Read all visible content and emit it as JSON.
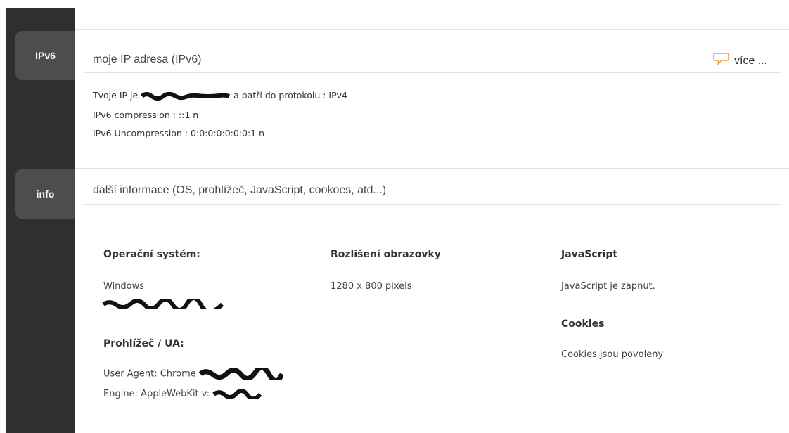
{
  "tabs": {
    "ipv6": "IPv6",
    "info": "info"
  },
  "ipv6_section": {
    "title": "moje IP adresa (IPv6)",
    "more_link": "více ...",
    "ip_prefix": "Tvoje IP je",
    "ip_suffix": "a patří do protokolu : IPv4",
    "compression": "IPv6 compression : ::1 n",
    "uncompression": "IPv6 Uncompression : 0:0:0:0:0:0:0:1 n"
  },
  "info_section": {
    "title": "další informace (OS, prohlížeč, JavaScript, cookoes, atd...)",
    "os": {
      "heading": "Operační systém:",
      "value": "Windows"
    },
    "browser": {
      "heading": "Prohlížeč / UA:",
      "user_agent": "User Agent: Chrome",
      "engine": "Engine: AppleWebKit v:"
    },
    "resolution": {
      "heading": "Rozlišení obrazovky",
      "value": "1280 x 800 pixels"
    },
    "javascript": {
      "heading": "JavaScript",
      "value": "JavaScript je zapnut."
    },
    "cookies": {
      "heading": "Cookies",
      "value": "Cookies jsou povoleny"
    }
  },
  "colors": {
    "sidebar": "#2f2f2f",
    "tab": "#4d4d4d",
    "divider": "#e4e4e4",
    "speech_icon": "#e8a33a"
  }
}
